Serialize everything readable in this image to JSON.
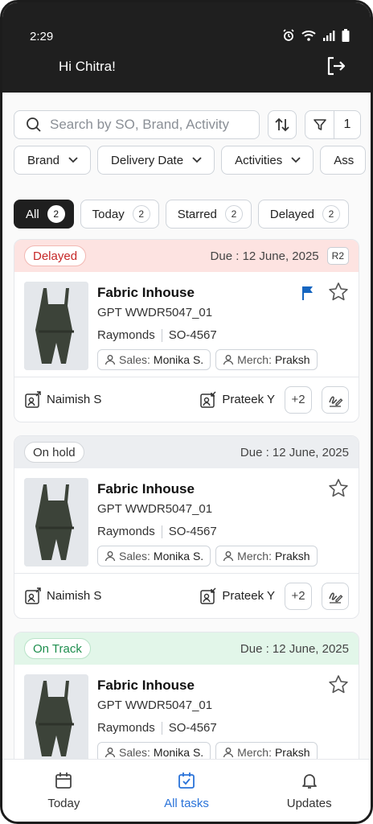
{
  "status_bar": {
    "time": "2:29"
  },
  "header": {
    "greeting": "Hi Chitra!"
  },
  "search": {
    "placeholder": "Search by SO, Brand, Activity"
  },
  "filter_count": "1",
  "filter_chips": [
    "Brand",
    "Delivery Date",
    "Activities",
    "Ass"
  ],
  "tabs": [
    {
      "label": "All",
      "count": "2"
    },
    {
      "label": "Today",
      "count": "2"
    },
    {
      "label": "Starred",
      "count": "2"
    },
    {
      "label": "Delayed",
      "count": "2"
    }
  ],
  "cards": [
    {
      "status": "Delayed",
      "due": "Due : 12 June, 2025",
      "revision": "R2",
      "title": "Fabric Inhouse",
      "code": "GPT WWDR5047_01",
      "brand": "Raymonds",
      "so": "SO-4567",
      "sales_label": "Sales:",
      "sales": "Monika S.",
      "merch_label": "Merch:",
      "merch": "Praksh",
      "assignee_from": "Naimish S",
      "assignee_to": "Prateek Y",
      "more": "+2"
    },
    {
      "status": "On hold",
      "due": "Due : 12 June, 2025",
      "title": "Fabric Inhouse",
      "code": "GPT WWDR5047_01",
      "brand": "Raymonds",
      "so": "SO-4567",
      "sales_label": "Sales:",
      "sales": "Monika S.",
      "merch_label": "Merch:",
      "merch": "Praksh",
      "assignee_from": "Naimish S",
      "assignee_to": "Prateek Y",
      "more": "+2"
    },
    {
      "status": "On Track",
      "due": "Due : 12 June, 2025",
      "title": "Fabric Inhouse",
      "code": "GPT WWDR5047_01",
      "brand": "Raymonds",
      "so": "SO-4567",
      "sales_label": "Sales:",
      "sales": "Monika S.",
      "merch_label": "Merch:",
      "merch": "Praksh"
    }
  ],
  "nav": [
    {
      "label": "Today",
      "icon": "calendar-icon"
    },
    {
      "label": "All tasks",
      "icon": "checkbox-calendar-icon"
    },
    {
      "label": "Updates",
      "icon": "bell-icon"
    }
  ],
  "colors": {
    "delayed_bg": "#fde3e1",
    "delayed_text": "#c62828",
    "hold_bg": "#eceef1",
    "hold_text": "#333333",
    "track_bg": "#e2f6e9",
    "track_text": "#1e8e4e",
    "accent": "#2a73d9",
    "header_bg": "#1f1f1f"
  }
}
